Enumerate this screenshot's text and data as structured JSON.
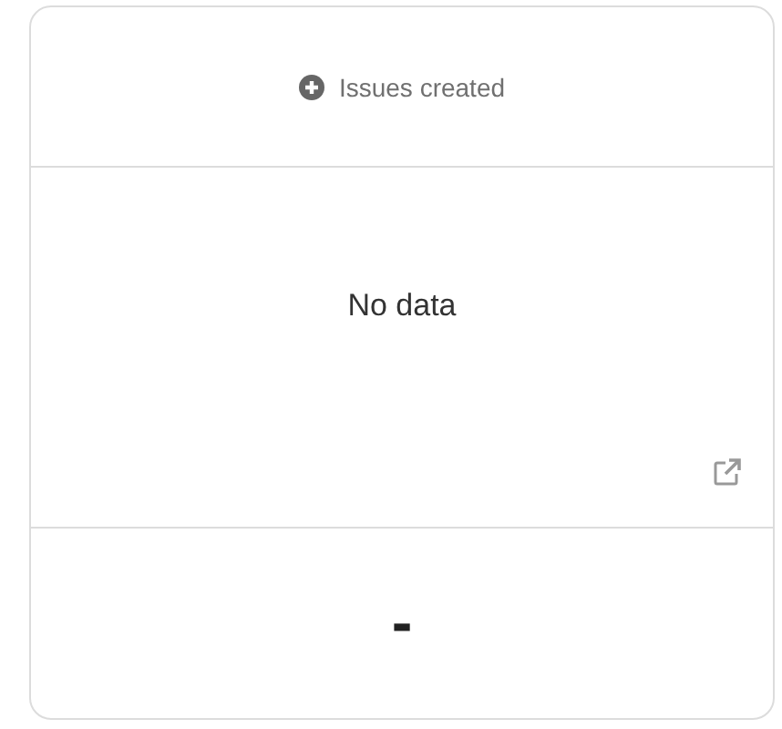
{
  "header": {
    "title": "Issues created"
  },
  "body": {
    "message": "No data"
  },
  "footer": {
    "value": "-"
  }
}
